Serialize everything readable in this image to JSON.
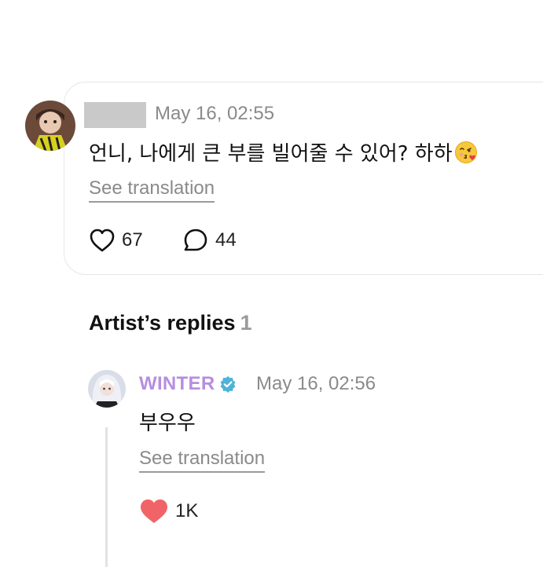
{
  "comment": {
    "timestamp": "May 16, 02:55",
    "text": "언니, 나에게 큰 부를 빌어줄 수 있어? 하하",
    "emoji": "kissing-face-with-heart-icon",
    "see_translation": "See translation",
    "likes": "67",
    "replies": "44"
  },
  "artist_replies": {
    "heading": "Artist’s replies",
    "count": "1"
  },
  "reply": {
    "author": "WINTER",
    "author_color": "#b58ee0",
    "verified_color": "#4fb3d9",
    "timestamp": "May 16, 02:56",
    "text": "부우우",
    "see_translation": "See translation",
    "likes": "1K",
    "like_color": "#f06468"
  }
}
